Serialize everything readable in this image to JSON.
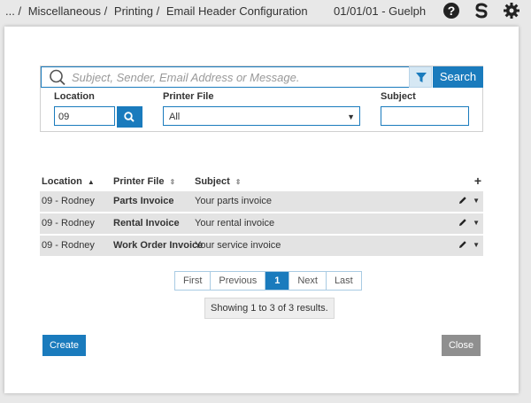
{
  "topbar": {
    "breadcrumbs": [
      "... /",
      "Miscellaneous /",
      "Printing /",
      "Email Header Configuration"
    ],
    "date_location": "01/01/01 - Guelph"
  },
  "search": {
    "placeholder": "Subject, Sender, Email Address or Message.",
    "button_label": "Search"
  },
  "filters": {
    "location_label": "Location",
    "location_value": "09",
    "printer_label": "Printer File",
    "printer_value": "All",
    "subject_label": "Subject",
    "subject_value": ""
  },
  "table": {
    "headers": [
      "Location",
      "Printer File",
      "Subject"
    ],
    "add_label": "+",
    "rows": [
      {
        "location": "09 - Rodney",
        "printer_file": "Parts Invoice",
        "subject": "Your parts invoice"
      },
      {
        "location": "09 - Rodney",
        "printer_file": "Rental Invoice",
        "subject": "Your rental invoice"
      },
      {
        "location": "09 - Rodney",
        "printer_file": "Work Order Invoice",
        "subject": "Your service invoice"
      }
    ]
  },
  "pagination": {
    "first": "First",
    "previous": "Previous",
    "current": "1",
    "next": "Next",
    "last": "Last",
    "results_text": "Showing 1 to 3 of 3 results."
  },
  "actions": {
    "create_label": "Create",
    "close_label": "Close"
  },
  "colors": {
    "accent": "#1a7bbd",
    "row_bg": "#e3e3e3",
    "close_bg": "#8f8f8f"
  }
}
